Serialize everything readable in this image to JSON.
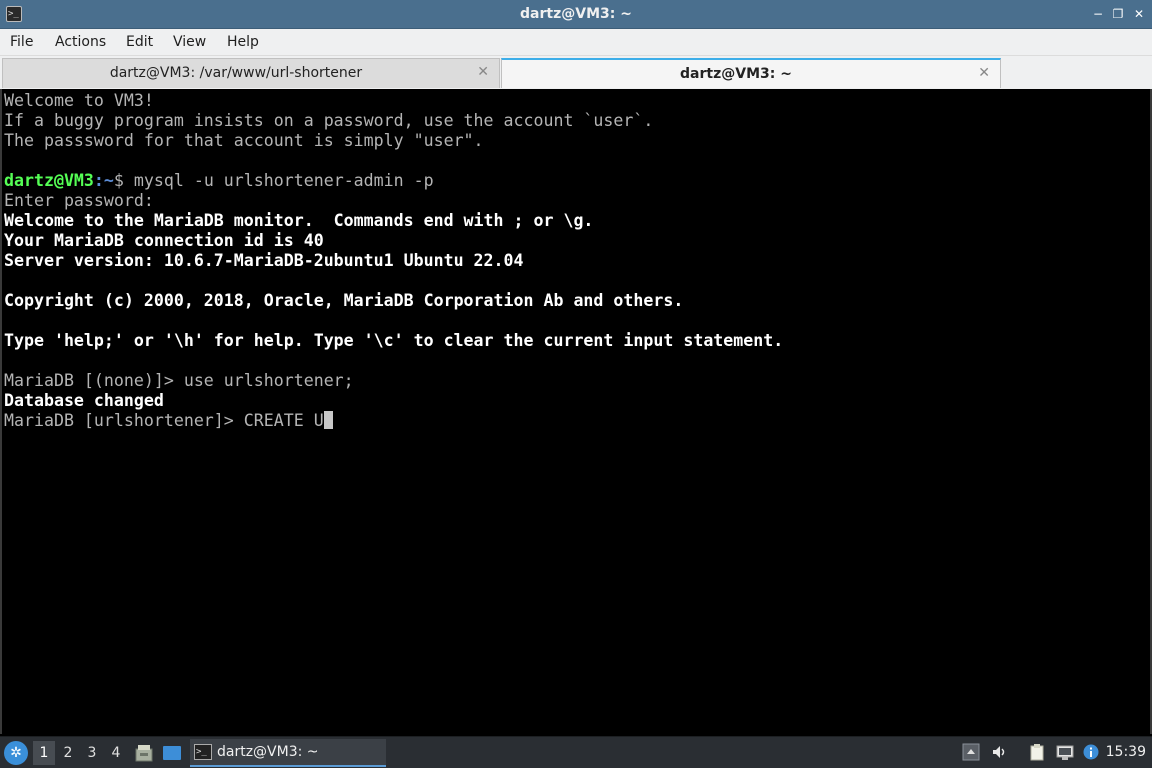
{
  "window": {
    "title": "dartz@VM3: ~",
    "minimize_glyph": "−",
    "restore_glyph": "❐",
    "close_glyph": "✕"
  },
  "menu": {
    "file": "File",
    "actions": "Actions",
    "edit": "Edit",
    "view": "View",
    "help": "Help"
  },
  "tabs": [
    {
      "label": "dartz@VM3: /var/www/url-shortener",
      "active": false
    },
    {
      "label": "dartz@VM3: ~",
      "active": true
    }
  ],
  "terminal": {
    "motd": [
      "Welcome to VM3!",
      "If a buggy program insists on a password, use the account `user`.",
      "The passsword for that account is simply \"user\"."
    ],
    "prompt_user": "dartz@VM3",
    "prompt_path": ":~",
    "prompt_symbol": "$",
    "command": " mysql -u urlshortener-admin -p",
    "enter_password": "Enter password:",
    "banner": [
      "Welcome to the MariaDB monitor.  Commands end with ; or \\g.",
      "Your MariaDB connection id is 40",
      "Server version: 10.6.7-MariaDB-2ubuntu1 Ubuntu 22.04",
      "Copyright (c) 2000, 2018, Oracle, MariaDB Corporation Ab and others.",
      "Type 'help;' or '\\h' for help. Type '\\c' to clear the current input statement."
    ],
    "mysql_prompt_1": "MariaDB [(none)]> use urlshortener;",
    "db_changed": "Database changed",
    "mysql_prompt_2": "MariaDB [urlshortener]> CREATE U"
  },
  "taskbar": {
    "workspaces": [
      "1",
      "2",
      "3",
      "4"
    ],
    "current_workspace": "1",
    "app_label": "dartz@VM3: ~",
    "clock": "15:39"
  },
  "colors": {
    "titlebar": "#4a6f8e",
    "prompt_user": "#55ff55",
    "prompt_path": "#5c8cd6",
    "taskbar": "#2a2e33"
  }
}
